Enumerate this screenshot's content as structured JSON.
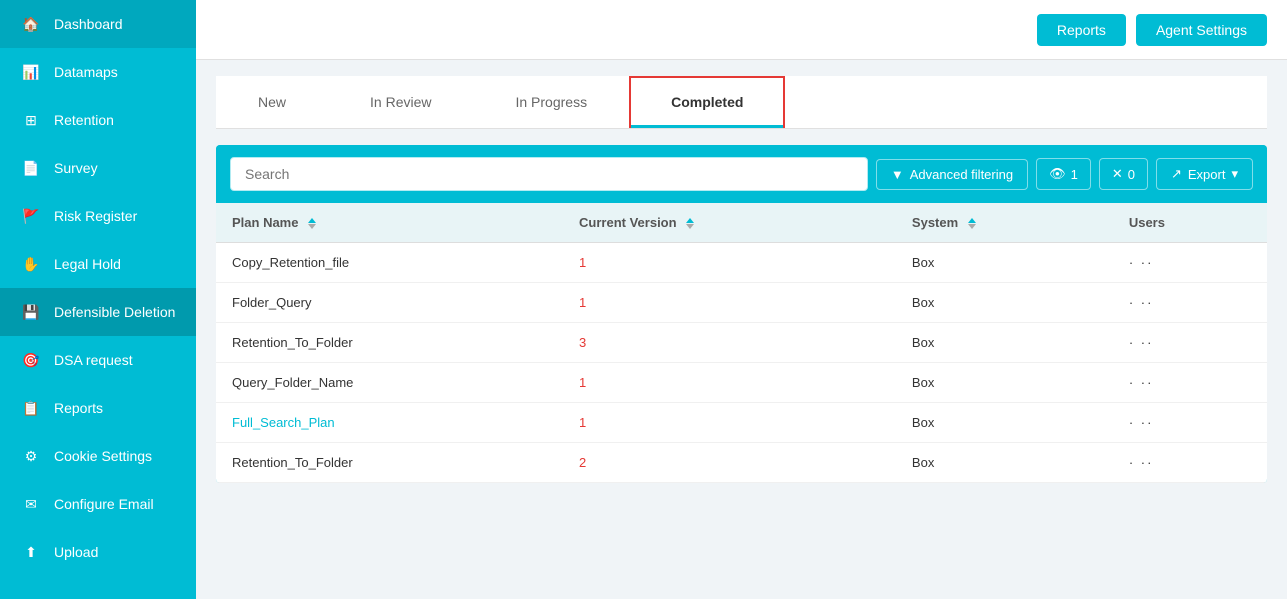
{
  "sidebar": {
    "items": [
      {
        "id": "dashboard",
        "label": "Dashboard",
        "icon": "🏠"
      },
      {
        "id": "datamaps",
        "label": "Datamaps",
        "icon": "📊"
      },
      {
        "id": "retention",
        "label": "Retention",
        "icon": "⊞"
      },
      {
        "id": "survey",
        "label": "Survey",
        "icon": "📄"
      },
      {
        "id": "risk-register",
        "label": "Risk Register",
        "icon": "🚩"
      },
      {
        "id": "legal-hold",
        "label": "Legal Hold",
        "icon": "✋"
      },
      {
        "id": "defensible-deletion",
        "label": "Defensible Deletion",
        "icon": "💾",
        "active": true
      },
      {
        "id": "dsa-request",
        "label": "DSA request",
        "icon": "🎯"
      },
      {
        "id": "reports",
        "label": "Reports",
        "icon": "📋"
      },
      {
        "id": "cookie-settings",
        "label": "Cookie Settings",
        "icon": "⚙"
      },
      {
        "id": "configure-email",
        "label": "Configure Email",
        "icon": "✉"
      },
      {
        "id": "upload",
        "label": "Upload",
        "icon": "⬆"
      }
    ]
  },
  "topbar": {
    "reports_label": "Reports",
    "agent_settings_label": "Agent Settings"
  },
  "tabs": [
    {
      "id": "new",
      "label": "New"
    },
    {
      "id": "in-review",
      "label": "In Review"
    },
    {
      "id": "in-progress",
      "label": "In Progress"
    },
    {
      "id": "completed",
      "label": "Completed",
      "active": true
    }
  ],
  "toolbar": {
    "search_placeholder": "Search",
    "advanced_filtering_label": "Advanced filtering",
    "filter_count": "1",
    "x_count": "0",
    "export_label": "Export"
  },
  "table": {
    "columns": [
      {
        "id": "plan-name",
        "label": "Plan Name"
      },
      {
        "id": "current-version",
        "label": "Current Version"
      },
      {
        "id": "system",
        "label": "System"
      },
      {
        "id": "users",
        "label": "Users"
      }
    ],
    "rows": [
      {
        "plan_name": "Copy_Retention_file",
        "version": "1",
        "system": "Box",
        "users": "·····",
        "link": false
      },
      {
        "plan_name": "Folder_Query",
        "version": "1",
        "system": "Box",
        "users": "·····",
        "link": false
      },
      {
        "plan_name": "Retention_To_Folder",
        "version": "3",
        "system": "Box",
        "users": "·····",
        "link": false
      },
      {
        "plan_name": "Query_Folder_Name",
        "version": "1",
        "system": "Box",
        "users": "·····",
        "link": false
      },
      {
        "plan_name": "Full_Search_Plan",
        "version": "1",
        "system": "Box",
        "users": "·····",
        "link": true
      },
      {
        "plan_name": "Retention_To_Folder",
        "version": "2",
        "system": "Box",
        "users": "·····",
        "link": false
      }
    ]
  }
}
